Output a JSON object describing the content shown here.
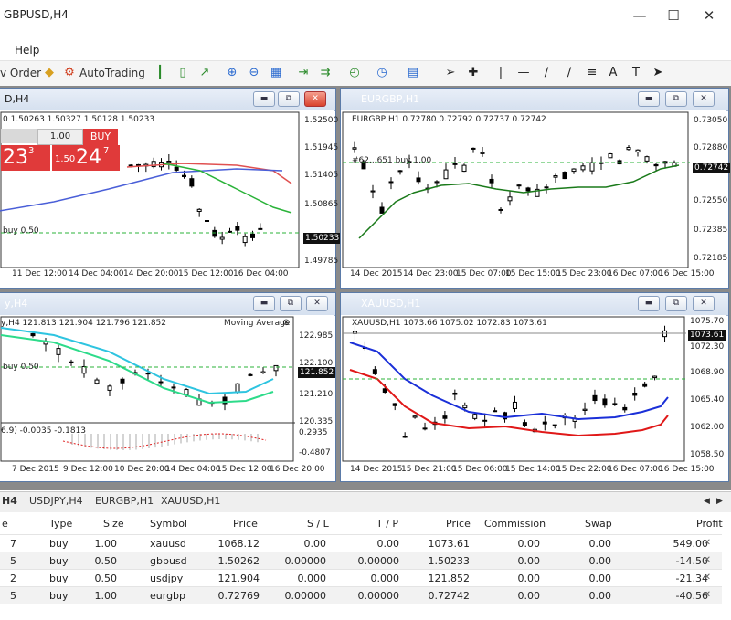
{
  "window": {
    "title": "GBPUSD,H4"
  },
  "menu": {
    "help": "Help"
  },
  "toolbar": {
    "new_order": "v Order",
    "autotrading": "AutoTrading"
  },
  "charts": {
    "gbpusd": {
      "title": "D,H4",
      "info": "0 1.50263 1.50327 1.50128 1.50233",
      "trade": {
        "lot": "1.00",
        "buy_label": "BUY",
        "sell_price": "23",
        "sell_sup": "3",
        "buy_price_small": "1.50",
        "buy_price": "24",
        "buy_sup": "7"
      },
      "buy_line_label": "buy 0.50",
      "y_labels": [
        "1.52500",
        "1.51945",
        "1.51405",
        "1.50865",
        "1.50233",
        "1.49785"
      ],
      "current_price": "1.50233",
      "x_labels": [
        "11 Dec 12:00",
        "14 Dec 04:00",
        "14 Dec 20:00",
        "15 Dec 12:00",
        "16 Dec 04:00"
      ],
      "colors": {
        "red_ma": "#e05050",
        "blue_ma": "#4a5fd8",
        "green_ma": "#2bb33a"
      }
    },
    "eurgbp": {
      "title": "EURGBP,H1",
      "info": "EURGBP,H1  0.72780 0.72792 0.72737 0.72742",
      "buy_line_label": "#62...651 buy 1.00",
      "y_labels": [
        "0.73050",
        "0.72880",
        "0.72742",
        "0.72550",
        "0.72385",
        "0.72185"
      ],
      "current_price": "0.72742",
      "x_labels": [
        "14 Dec 2015",
        "14 Dec 23:00",
        "15 Dec 07:00",
        "15 Dec 15:00",
        "15 Dec 23:00",
        "16 Dec 07:00",
        "16 Dec 15:00"
      ],
      "colors": {
        "ma": "#1a7a1a"
      }
    },
    "usdjpy": {
      "title": "y,H4",
      "info": "y,H4  121.813 121.904 121.796 121.852",
      "indicator_label": "Moving Average",
      "buy_line_label": "buy 0.50",
      "y_labels": [
        "122.985",
        "122.100",
        "121.852",
        "121.210",
        "120.335"
      ],
      "current_price": "121.852",
      "osc_info": "6.9) -0.0035 -0.1813",
      "osc_y_labels": [
        "0.2935",
        "-0.4807"
      ],
      "x_labels": [
        "7 Dec 2015",
        "9 Dec 12:00",
        "10 Dec 20:00",
        "14 Dec 04:00",
        "15 Dec 12:00",
        "16 Dec 20:00"
      ],
      "colors": {
        "band_upper": "#2ec4e0",
        "band_lower": "#2ddb8a"
      }
    },
    "xauusd": {
      "title": "XAUUSD,H1",
      "info": "XAUUSD,H1  1073.66 1075.02 1072.83 1073.61",
      "y_labels": [
        "1075.70",
        "1073.61",
        "1072.30",
        "1068.90",
        "1065.40",
        "1062.00",
        "1058.50"
      ],
      "current_price": "1073.61",
      "x_labels": [
        "14 Dec 2015",
        "15 Dec 21:00",
        "15 Dec 06:00",
        "15 Dec 14:00",
        "15 Dec 22:00",
        "16 Dec 07:00",
        "16 Dec 15:00"
      ],
      "colors": {
        "blue_ma": "#1a2fd8",
        "red_ma": "#e01818"
      }
    }
  },
  "terminal": {
    "tabs": [
      "H4",
      "USDJPY,H4",
      "EURGBP,H1",
      "XAUUSD,H1"
    ],
    "headers": [
      "e",
      "Type",
      "Size",
      "Symbol",
      "Price",
      "S / L",
      "T / P",
      "Price",
      "Commission",
      "Swap",
      "Profit"
    ],
    "rows": [
      [
        "7",
        "buy",
        "1.00",
        "xauusd",
        "1068.12",
        "0.00",
        "0.00",
        "1073.61",
        "0.00",
        "0.00",
        "549.00"
      ],
      [
        "5",
        "buy",
        "0.50",
        "gbpusd",
        "1.50262",
        "0.00000",
        "0.00000",
        "1.50233",
        "0.00",
        "0.00",
        "-14.50"
      ],
      [
        "2",
        "buy",
        "0.50",
        "usdjpy",
        "121.904",
        "0.000",
        "0.000",
        "121.852",
        "0.00",
        "0.00",
        "-21.34"
      ],
      [
        "5",
        "buy",
        "1.00",
        "eurgbp",
        "0.72769",
        "0.00000",
        "0.00000",
        "0.72742",
        "0.00",
        "0.00",
        "-40.56"
      ]
    ]
  }
}
